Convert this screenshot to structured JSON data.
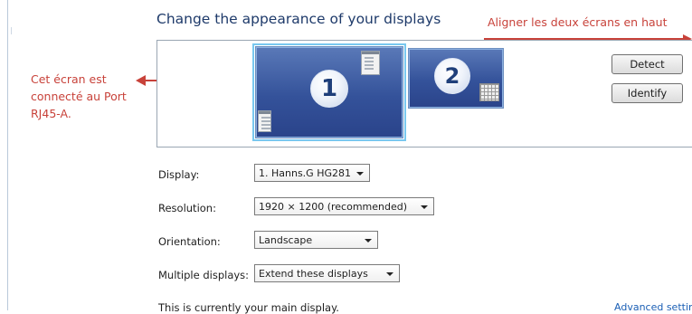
{
  "title": "Change the appearance of your displays",
  "annotations": {
    "top_note": "Aligner les deux écrans en haut",
    "left_note": "Cet écran est connecté au Port RJ45-A."
  },
  "monitors": [
    {
      "number": "1",
      "selected": true
    },
    {
      "number": "2",
      "selected": false
    }
  ],
  "buttons": {
    "detect": "Detect",
    "identify": "Identify"
  },
  "settings": [
    {
      "label": "Display:",
      "value": "1. Hanns.G HG281"
    },
    {
      "label": "Resolution:",
      "value": "1920 × 1200 (recommended)"
    },
    {
      "label": "Orientation:",
      "value": "Landscape"
    },
    {
      "label": "Multiple displays:",
      "value": "Extend these displays"
    }
  ],
  "footer": {
    "status": "This is currently your main display.",
    "advanced_link": "Advanced settings"
  },
  "colors": {
    "annotation": "#c8423a",
    "title": "#1e3a6a",
    "monitor_fill": "#34529a",
    "selection_outline": "#79c8ef",
    "link": "#1b5fb5"
  }
}
